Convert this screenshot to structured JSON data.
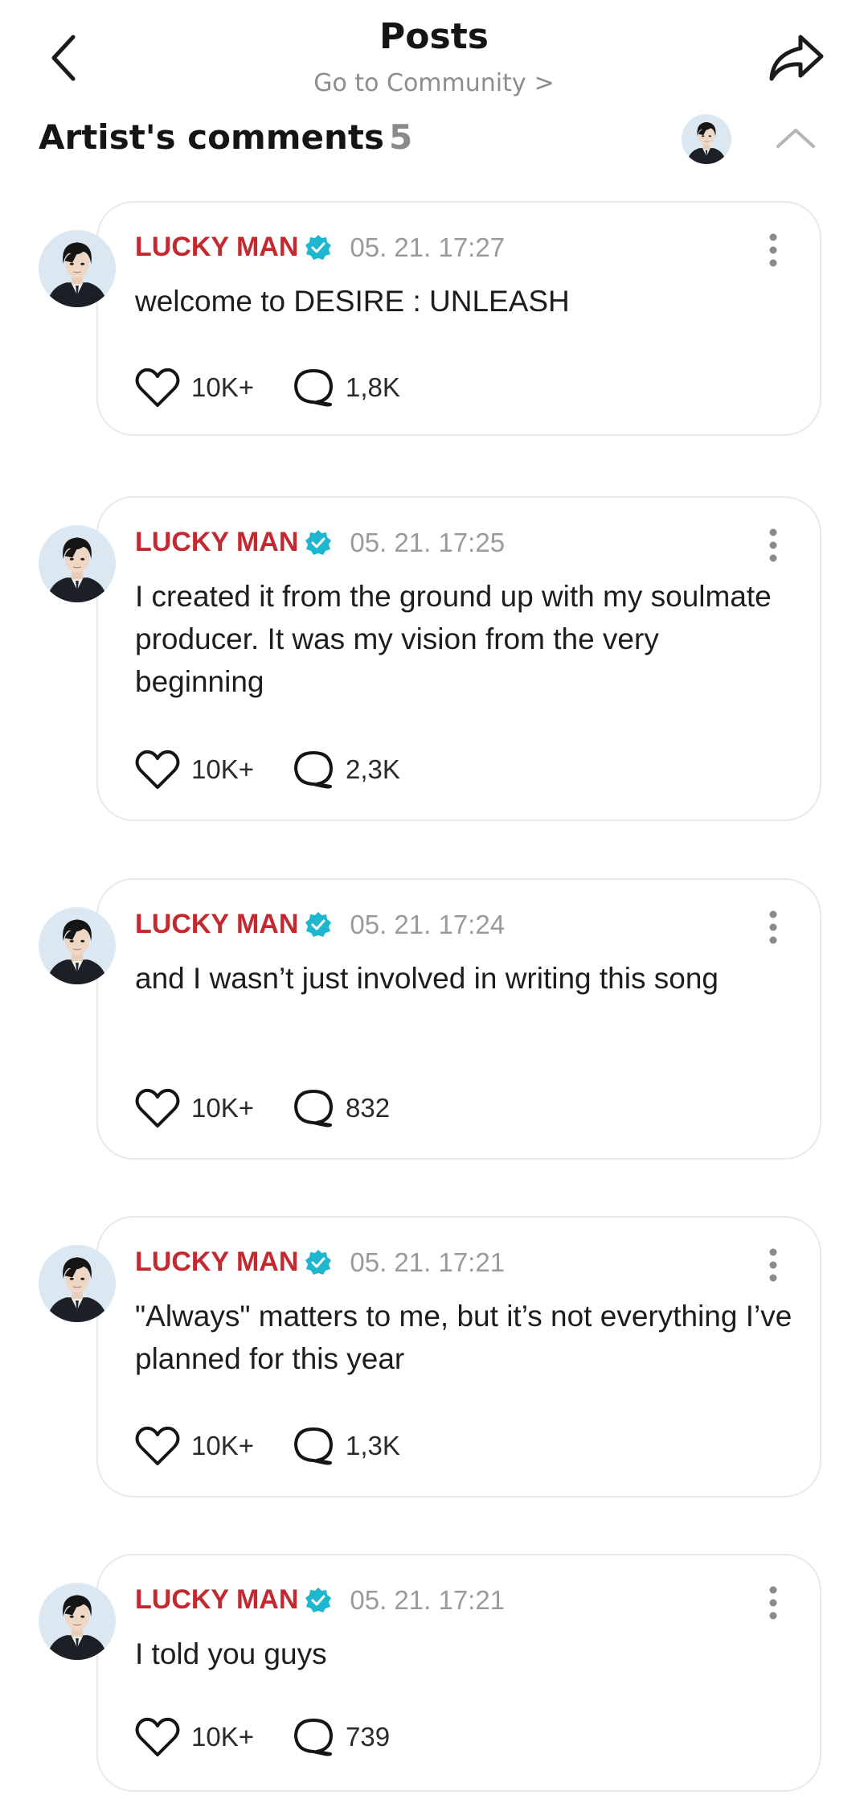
{
  "header": {
    "title": "Posts",
    "subtitle": "Go to Community",
    "subtitle_chevron": ">",
    "back_icon": "chevron-left-icon",
    "share_icon": "share-forward-icon"
  },
  "section": {
    "title": "Artist's comments",
    "count": "5",
    "collapse_icon": "chevron-up-icon"
  },
  "colors": {
    "author": "#c4292f",
    "verified": "#1fb6cf",
    "muted": "#9a9a9a"
  },
  "comments": [
    {
      "author": "LUCKY MAN",
      "time": "05. 21. 17:27",
      "text": "welcome to DESIRE : UNLEASH",
      "likes": "10K+",
      "replies": "1,8K"
    },
    {
      "author": "LUCKY MAN",
      "time": "05. 21. 17:25",
      "text": "I created it from the ground up with my soulmate producer. It was my vision from the very beginning",
      "likes": "10K+",
      "replies": "2,3K"
    },
    {
      "author": "LUCKY MAN",
      "time": "05. 21. 17:24",
      "text": "and I wasn’t just involved in writing this song",
      "likes": "10K+",
      "replies": "832"
    },
    {
      "author": "LUCKY MAN",
      "time": "05. 21. 17:21",
      "text": "\"Always\" matters to me, but it’s not everything I’ve planned for this year",
      "likes": "10K+",
      "replies": "1,3K"
    },
    {
      "author": "LUCKY MAN",
      "time": "05. 21. 17:21",
      "text": "I told you guys",
      "likes": "10K+",
      "replies": "739"
    }
  ]
}
